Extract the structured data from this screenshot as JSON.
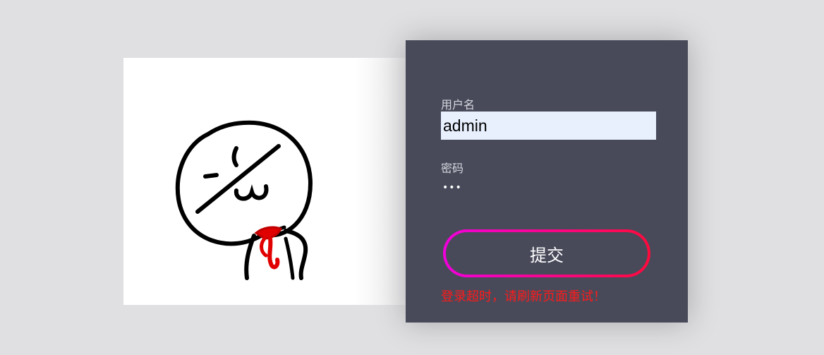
{
  "form": {
    "username_label": "用户名",
    "username_value": "admin",
    "password_label": "密码",
    "password_value": "abc",
    "submit_label": "提交",
    "error_message": "登录超时，请刷新页面重试！"
  },
  "illustration": {
    "icon": "stick-figure-face-icon"
  },
  "colors": {
    "background": "#e0e0e3",
    "card": "#484a5a",
    "input_fill": "#e8f0fe",
    "button_gradient_start": "#f000dc",
    "button_gradient_end": "#ff0a3c",
    "error": "#ff1a1a"
  }
}
